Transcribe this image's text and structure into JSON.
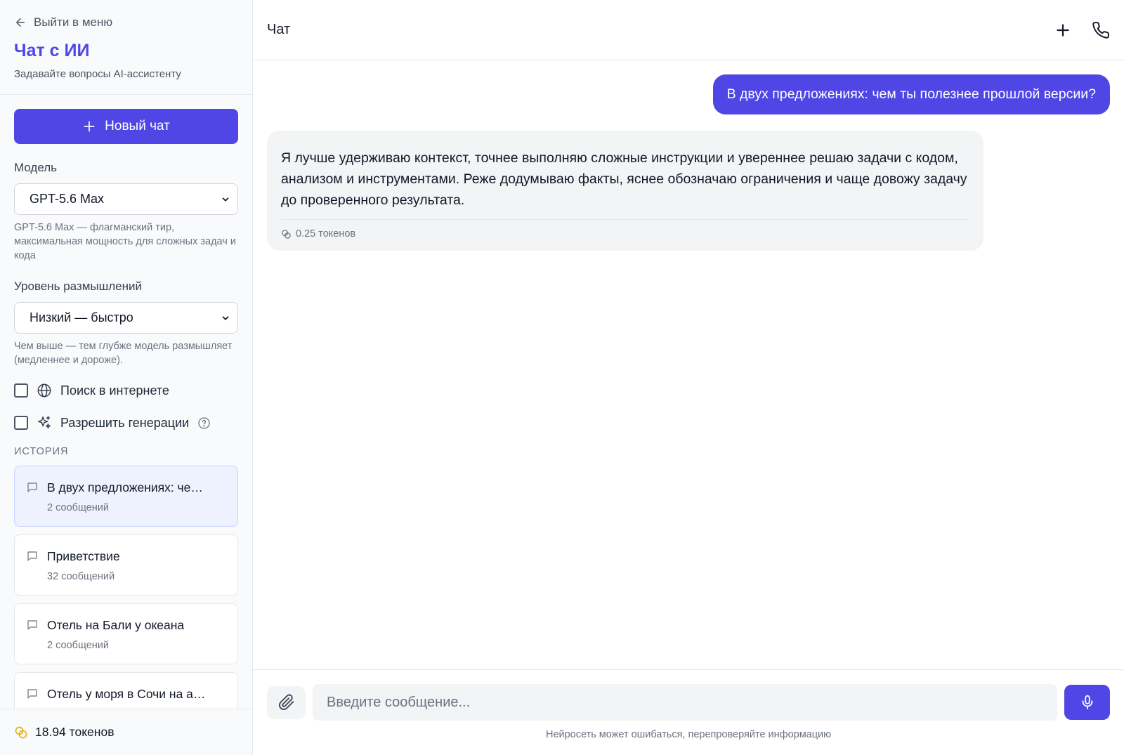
{
  "colors": {
    "accent": "#4f46e5",
    "active_bg": "#eef2ff",
    "token_icon": "#eab308"
  },
  "sidebar": {
    "back_label": "Выйти в меню",
    "title": "Чат с ИИ",
    "subtitle": "Задавайте вопросы AI-ассистенту",
    "new_chat_label": "Новый чат",
    "model": {
      "label": "Модель",
      "selected": "GPT-5.6 Max",
      "hint": "GPT-5.6 Max — флагманский тир, максимальная мощность для сложных задач и кода"
    },
    "thinking": {
      "label": "Уровень размышлений",
      "selected": "Низкий — быстро",
      "hint": "Чем выше — тем глубже модель размышляет (медленнее и дороже)."
    },
    "web_search": {
      "label": "Поиск в интернете",
      "checked": false
    },
    "generations": {
      "label": "Разрешить генерации",
      "checked": false
    },
    "history_label": "ИСТОРИЯ",
    "history": [
      {
        "title": "В двух предложениях: че…",
        "count": "2 сообщений",
        "active": true
      },
      {
        "title": "Приветствие",
        "count": "32 сообщений",
        "active": false
      },
      {
        "title": "Отель на Бали у океана",
        "count": "2 сообщений",
        "active": false
      },
      {
        "title": "Отель у моря в Сочи на а…",
        "count": "",
        "active": false
      }
    ],
    "balance": "18.94 токенов"
  },
  "main": {
    "title": "Чат",
    "messages": {
      "user": "В двух предложениях: чем ты полезнее прошлой версии?",
      "assistant": "Я лучше удерживаю контекст, точнее выполняю сложные инструкции и увереннее решаю задачи с кодом, анализом и инструментами. Реже додумываю факты, яснее обозначаю ограничения и чаще довожу задачу до проверенного результата.",
      "assistant_cost": "0.25 токенов"
    },
    "composer": {
      "placeholder": "Введите сообщение...",
      "disclaimer": "Нейросеть может ошибаться, перепроверяйте информацию"
    }
  }
}
